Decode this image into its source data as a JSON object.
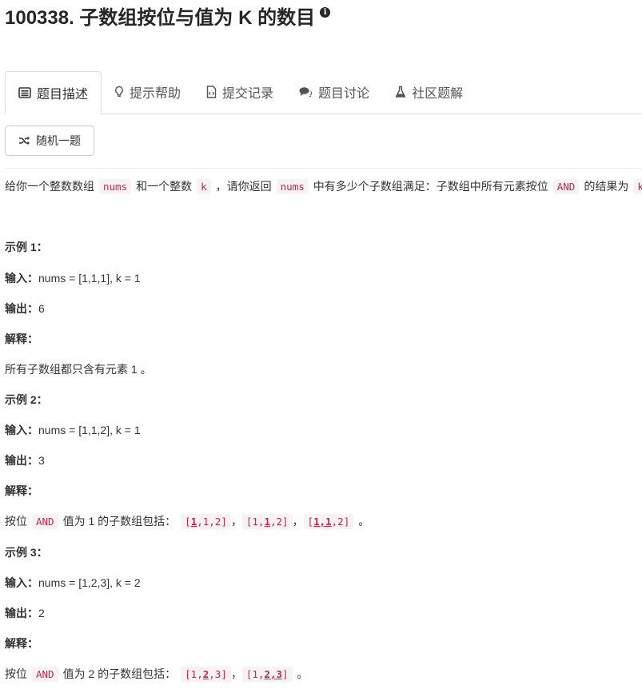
{
  "problem": {
    "title": "100338. 子数组按位与值为 K 的数目",
    "info_glyph": "i"
  },
  "tabs": [
    {
      "label": "题目描述",
      "icon": "description-icon"
    },
    {
      "label": "提示帮助",
      "icon": "lightbulb-icon"
    },
    {
      "label": "提交记录",
      "icon": "code-file-icon"
    },
    {
      "label": "题目讨论",
      "icon": "comments-icon"
    },
    {
      "label": "社区题解",
      "icon": "flask-icon"
    }
  ],
  "random_button": {
    "label": "随机一题",
    "icon": "shuffle-icon"
  },
  "description": {
    "t1": "给你一个整数数组",
    "c1": "nums",
    "t2": "和一个整数",
    "c2": "k",
    "t3": "，请你返回",
    "c3": "nums",
    "t4": "中有多少个子数组满足：子数组中所有元素按位",
    "c4": "AND",
    "t5": "的结果为",
    "c5": "k",
    "t6": "。"
  },
  "examples": [
    {
      "heading": "示例 1：",
      "input_label": "输入：",
      "input": "nums = [1,1,1], k = 1",
      "output_label": "输出：",
      "output": "6",
      "explain_label": "解释：",
      "explanation": "所有子数组都只含有元素 1 。"
    },
    {
      "heading": "示例 2：",
      "input_label": "输入：",
      "input": "nums = [1,1,2], k = 1",
      "output_label": "输出：",
      "output": "3",
      "explain_label": "解释：",
      "exp_pre": "按位",
      "exp_code": "AND",
      "exp_mid": "值为 1 的子数组包括：",
      "arrays": [
        {
          "pre": "[",
          "hl": "1",
          "post": ",1,2]"
        },
        {
          "pre": "[1,",
          "hl": "1",
          "post": ",2]"
        },
        {
          "pre": "[",
          "hl": "1,1",
          "post": ",2]"
        }
      ],
      "sep": "，",
      "exp_end": "。"
    },
    {
      "heading": "示例 3：",
      "input_label": "输入：",
      "input": "nums = [1,2,3], k = 2",
      "output_label": "输出：",
      "output": "2",
      "explain_label": "解释：",
      "exp_pre": "按位",
      "exp_code": "AND",
      "exp_mid": "值为 2 的子数组包括：",
      "arrays": [
        {
          "pre": "[1,",
          "hl": "2",
          "post": ",3]"
        },
        {
          "pre": "[1,",
          "hl": "2,3",
          "post": "]"
        }
      ],
      "sep": "，",
      "exp_end": "。"
    }
  ]
}
